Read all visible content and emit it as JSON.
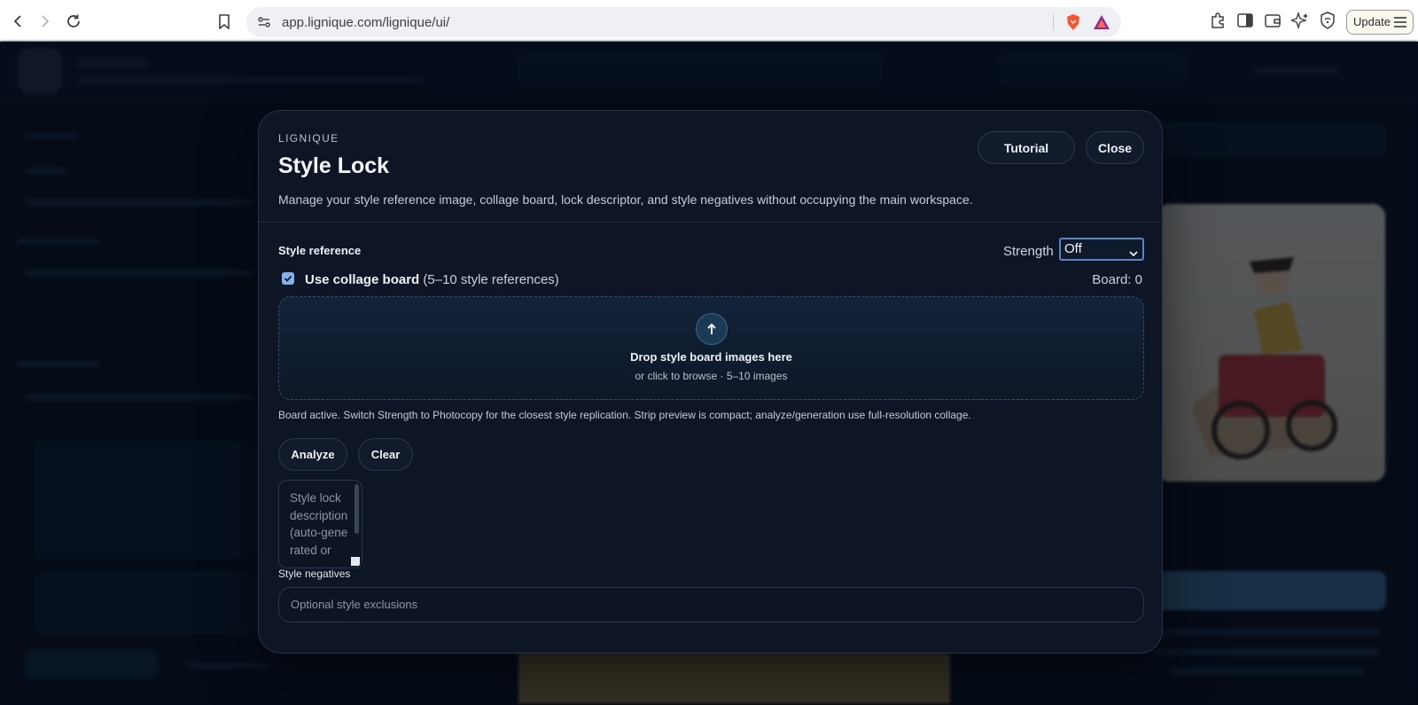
{
  "browser": {
    "url": "app.lignique.com/lignique/ui/",
    "update_label": "Update"
  },
  "modal": {
    "eyebrow": "LIGNIQUE",
    "title": "Style Lock",
    "description": "Manage your style reference image, collage board, lock descriptor, and style negatives without occupying the main workspace.",
    "tutorial_label": "Tutorial",
    "close_label": "Close",
    "style_reference": {
      "label": "Style reference",
      "strength_label": "Strength",
      "strength_value": "Off",
      "use_collage_checked": true,
      "use_collage_label": "Use collage board",
      "use_collage_hint": "(5–10 style references)",
      "board_count": "Board: 0"
    },
    "dropzone": {
      "title": "Drop style board images here",
      "subtitle": "or click to browse · 5–10 images"
    },
    "hint": "Board active. Switch Strength to Photocopy for the closest style replication. Strip preview is compact; analyze/generation use full-resolution collage.",
    "analyze_label": "Analyze",
    "clear_label": "Clear",
    "description_placeholder": "Style lock description (auto-generated or",
    "negatives_label": "Style negatives",
    "negatives_placeholder": "Optional style exclusions"
  },
  "colors": {
    "accent": "#7fb2ee",
    "modal_bg": "#0e1626",
    "page_bg": "#0a1220"
  }
}
